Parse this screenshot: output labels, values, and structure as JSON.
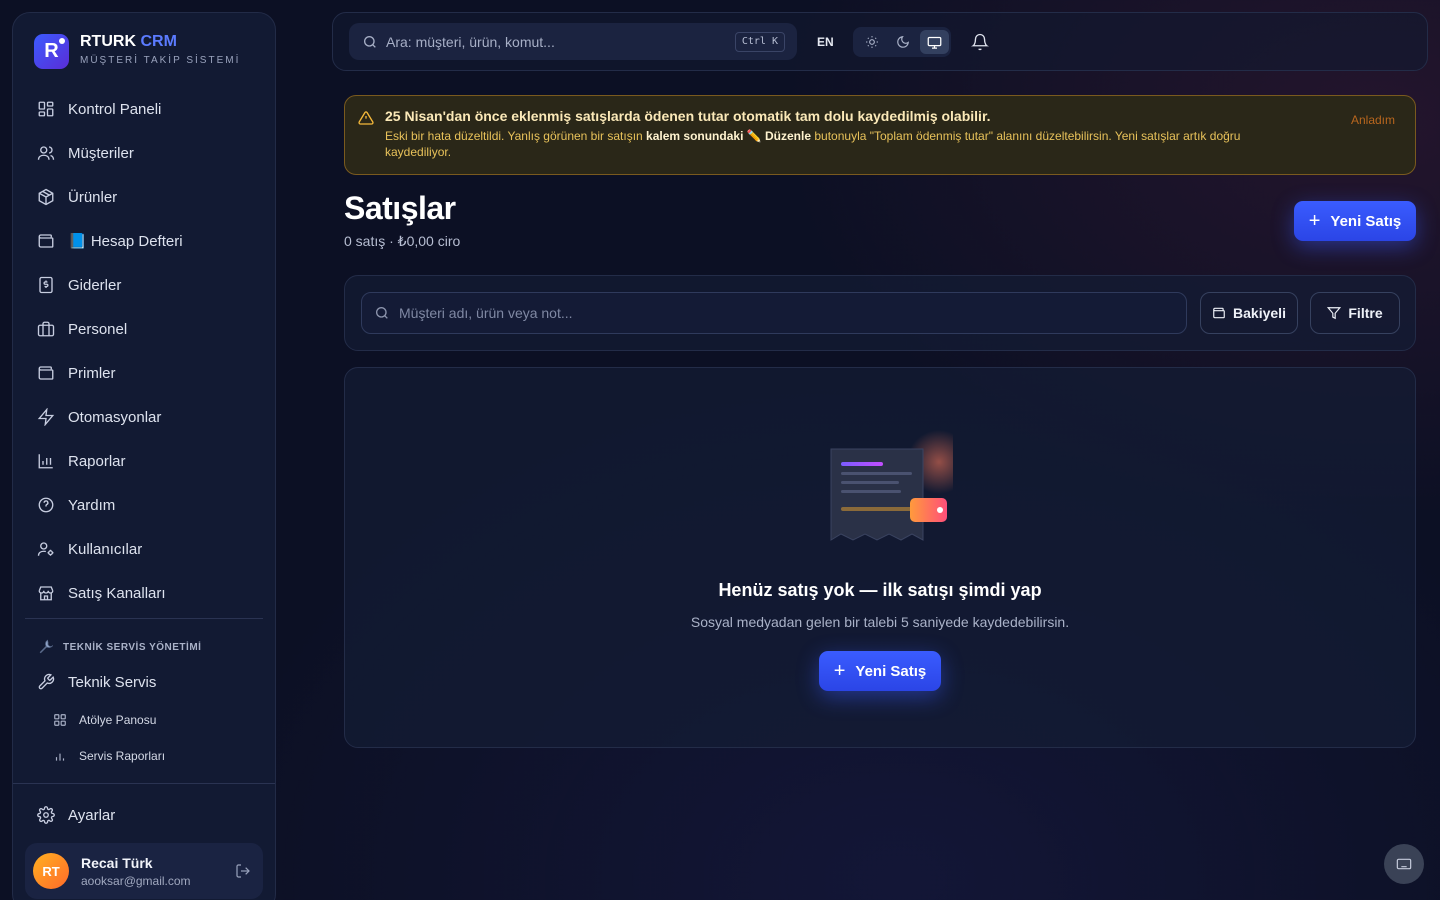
{
  "brand": {
    "name": "RTURK",
    "accent": "CRM",
    "subtitle": "MÜŞTERİ TAKİP SİSTEMİ",
    "logo_letter": "R"
  },
  "sidebar": {
    "items": [
      {
        "label": "Kontrol Paneli",
        "icon": "dashboard-icon"
      },
      {
        "label": "Müşteriler",
        "icon": "users-icon"
      },
      {
        "label": "Ürünler",
        "icon": "package-icon"
      },
      {
        "label": "📘 Hesap Defteri",
        "icon": "wallet-icon"
      },
      {
        "label": "Giderler",
        "icon": "receipt-icon"
      },
      {
        "label": "Personel",
        "icon": "briefcase-icon"
      },
      {
        "label": "Primler",
        "icon": "wallet-icon"
      },
      {
        "label": "Otomasyonlar",
        "icon": "lightning-icon"
      },
      {
        "label": "Raporlar",
        "icon": "bar-chart-icon"
      },
      {
        "label": "Yardım",
        "icon": "help-icon"
      },
      {
        "label": "Kullanıcılar",
        "icon": "user-cog-icon"
      },
      {
        "label": "Satış Kanalları",
        "icon": "store-icon"
      }
    ],
    "section_title": "TEKNİK SERVİS YÖNETİMİ",
    "service_item": "Teknik Servis",
    "sub_items": [
      {
        "label": "Atölye Panosu",
        "icon": "grid-icon"
      },
      {
        "label": "Servis Raporları",
        "icon": "bar-chart-icon"
      }
    ],
    "settings": "Ayarlar",
    "user": {
      "initials": "RT",
      "name": "Recai Türk",
      "email": "aooksar@gmail.com"
    }
  },
  "topbar": {
    "search_placeholder": "Ara: müşteri, ürün, komut...",
    "shortcut": "Ctrl K",
    "lang": "EN",
    "theme_options": [
      "light",
      "dark",
      "system"
    ],
    "theme_selected": "system"
  },
  "alert": {
    "title": "25 Nisan'dan önce eklenmiş satışlarda ödenen tutar otomatik tam dolu kaydedilmiş olabilir.",
    "body_1": "Eski bir hata düzeltildi. Yanlış görünen bir satışın ",
    "body_bold_1": "kalem sonundaki",
    "body_2": " ✏️ ",
    "body_bold_2": "Düzenle",
    "body_3": " butonuyla \"Toplam ödenmiş tutar\" alanını düzeltebilirsin. Yeni satışlar artık doğru kaydediliyor.",
    "dismiss": "Anladım"
  },
  "page": {
    "title": "Satışlar",
    "subtitle": "0 satış · ₺0,00 ciro",
    "new_sale": "Yeni Satış"
  },
  "filters": {
    "search_placeholder": "Müşteri adı, ürün veya not...",
    "balance_button": "Bakiyeli",
    "filter_button": "Filtre"
  },
  "empty_state": {
    "title": "Henüz satış yok — ilk satışı şimdi yap",
    "subtitle": "Sosyal medyadan gelen bir talebi 5 saniyede kaydedebilirsin.",
    "cta": "Yeni Satış"
  },
  "colors": {
    "accent": "#3a5cff",
    "warning": "#f5b93a",
    "bg": "#0c1024"
  }
}
